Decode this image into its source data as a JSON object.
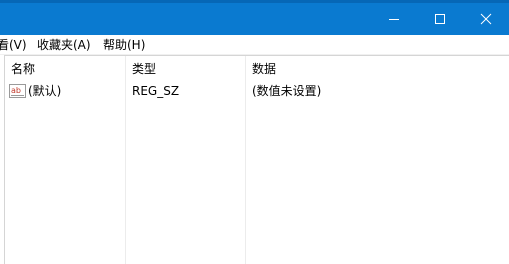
{
  "window": {
    "controls": {
      "minimize_icon": "minimize-icon",
      "maximize_icon": "maximize-icon",
      "close_icon": "close-icon"
    },
    "titlebar_color": "#0a7ad0"
  },
  "menubar": {
    "items": [
      {
        "label": "看(V)"
      },
      {
        "label": "收藏夹(A)"
      },
      {
        "label": "帮助(H)"
      }
    ]
  },
  "list": {
    "columns": [
      "名称",
      "类型",
      "数据"
    ],
    "rows": [
      {
        "icon": "string-value-icon",
        "name": "(默认)",
        "type": "REG_SZ",
        "data": "(数值未设置)"
      }
    ]
  }
}
